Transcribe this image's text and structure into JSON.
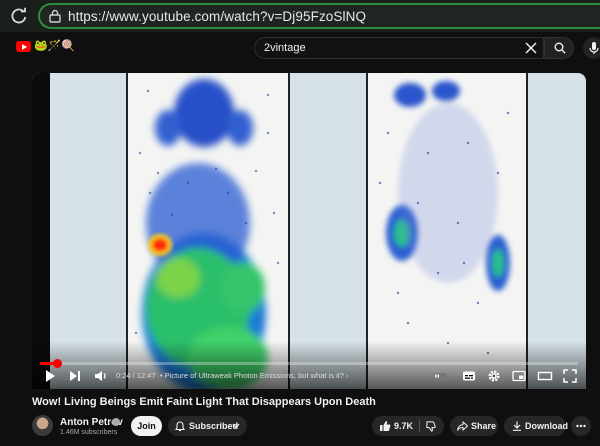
{
  "browser": {
    "url": "https://www.youtube.com/watch?v=Dj95FzoSlNQ"
  },
  "youtube_header": {
    "logo_icon": "youtube-logo-icon",
    "search_query": "2vintage"
  },
  "video": {
    "current_time": "0:24 / 12:47",
    "chapter": "• Picture of Ultraweak Photon Emissions, but what is it? ›",
    "progress_fraction": 0.032,
    "accent_color": "#ff0000"
  },
  "meta": {
    "title": "Wow! Living Beings Emit Faint Light That Disappears Upon Death",
    "channel_name": "Anton Petrov",
    "subscribers": "1.46M subscribers",
    "join_label": "Join",
    "subscribed_label": "Subscribed",
    "like_count": "9.7K",
    "share_label": "Share",
    "download_label": "Download"
  }
}
